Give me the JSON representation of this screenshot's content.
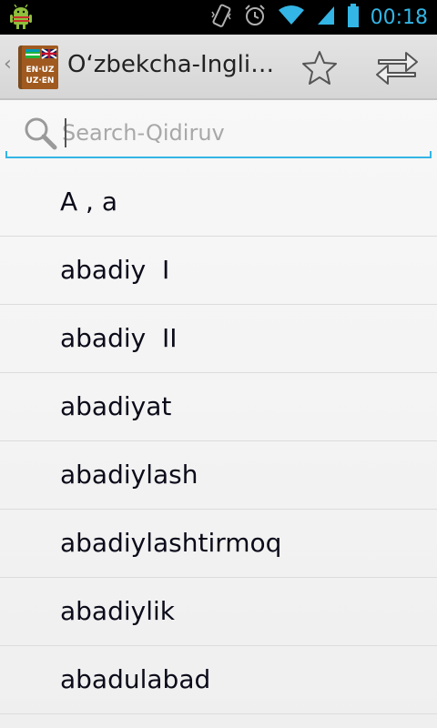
{
  "status_bar": {
    "time": "00:18",
    "icons": [
      "android-debug-icon",
      "vibrate-icon",
      "alarm-icon",
      "wifi-icon",
      "signal-icon",
      "battery-icon"
    ]
  },
  "action_bar": {
    "title": "O‘zbekcha-Ingliz...",
    "app_icon_text_top": "EN·UZ",
    "app_icon_text_bottom": "UZ·EN",
    "icons": [
      "star-icon",
      "swap-arrows-icon"
    ]
  },
  "search": {
    "placeholder": "Search-Qidiruv",
    "value": ""
  },
  "words": [
    {
      "label": "A , a"
    },
    {
      "label": "abadiy  I"
    },
    {
      "label": "abadiy  II"
    },
    {
      "label": "abadiyat"
    },
    {
      "label": "abadiylash"
    },
    {
      "label": "abadiylashtirmoq"
    },
    {
      "label": "abadiylik"
    },
    {
      "label": "abadulabad"
    }
  ],
  "colors": {
    "accent": "#33b5e5",
    "text": "#0b0b1a",
    "placeholder": "#a8a8a8"
  }
}
